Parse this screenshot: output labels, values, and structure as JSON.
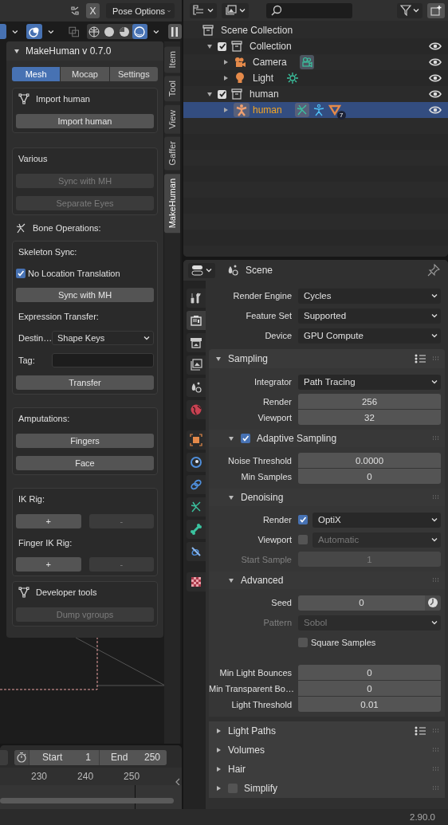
{
  "viewport_header": {
    "close_label": "X",
    "pose_options": "Pose Options"
  },
  "shading": [
    {
      "kind": "wireframe",
      "selected": false
    },
    {
      "kind": "solid",
      "selected": false
    },
    {
      "kind": "material",
      "selected": false
    },
    {
      "kind": "rendered",
      "selected": true
    }
  ],
  "n_panel": {
    "title": "MakeHuman v 0.7.0",
    "tabs": [
      {
        "label": "Mesh",
        "selected": true
      },
      {
        "label": "Mocap",
        "selected": false
      },
      {
        "label": "Settings",
        "selected": false
      }
    ],
    "blocks": [
      {
        "kind": "icon_box",
        "title": "Import human",
        "rows": [
          {
            "kind": "button",
            "label": "Import human",
            "disabled": false
          }
        ]
      },
      {
        "kind": "box",
        "title": "Various",
        "rows": [
          {
            "kind": "button",
            "label": "Sync with MH",
            "disabled": true
          },
          {
            "kind": "button",
            "label": "Separate Eyes",
            "disabled": true
          }
        ]
      },
      {
        "kind": "heading",
        "title": "Bone Operations:"
      },
      {
        "kind": "box",
        "title": "Skeleton Sync:",
        "rows": [
          {
            "kind": "checkbox",
            "label": "No Location Translation",
            "checked": true
          },
          {
            "kind": "button",
            "label": "Sync with MH",
            "disabled": false
          },
          {
            "kind": "label",
            "label": "Expression Transfer:"
          },
          {
            "kind": "dropdown",
            "label": "Destin…",
            "value": "Shape Keys"
          },
          {
            "kind": "text_field",
            "label": "Tag:"
          },
          {
            "kind": "button",
            "label": "Transfer",
            "disabled": false
          }
        ]
      },
      {
        "kind": "box",
        "title": "Amputations:",
        "rows": [
          {
            "kind": "button",
            "label": "Fingers",
            "disabled": false
          },
          {
            "kind": "button",
            "label": "Face",
            "disabled": false
          }
        ]
      },
      {
        "kind": "box",
        "title": "IK Rig:",
        "rows": [
          {
            "kind": "button_pair",
            "buttons": [
              {
                "label": "+",
                "disabled": false
              },
              {
                "label": "-",
                "disabled": true
              }
            ]
          },
          {
            "kind": "label",
            "label": "Finger IK Rig:"
          },
          {
            "kind": "button_pair",
            "buttons": [
              {
                "label": "+",
                "disabled": false
              },
              {
                "label": "-",
                "disabled": true
              }
            ]
          }
        ]
      },
      {
        "kind": "icon_box",
        "title": "Developer tools",
        "rows": [
          {
            "kind": "button",
            "label": "Dump vgroups",
            "disabled": true
          }
        ]
      }
    ]
  },
  "sidebar_tabs": [
    {
      "label": "Item",
      "selected": false
    },
    {
      "label": "Tool",
      "selected": false
    },
    {
      "label": "View",
      "selected": false
    },
    {
      "label": "Gaffer",
      "selected": false
    },
    {
      "label": "MakeHuman",
      "selected": true
    }
  ],
  "timeline": {
    "start_label": "Start",
    "start": "1",
    "end_label": "End",
    "end": "250",
    "ticks": [
      "230",
      "240",
      "250"
    ]
  },
  "outliner": {
    "items": [
      {
        "label": "Scene Collection",
        "kind": "scene_collection",
        "selected": false,
        "children": [
          {
            "label": "Collection",
            "kind": "collection",
            "checked": true,
            "expanded": true,
            "visible": true,
            "selected": false,
            "children": [
              {
                "label": "Camera",
                "kind": "camera",
                "expanded": false,
                "visible": true,
                "selected": false
              },
              {
                "label": "Light",
                "kind": "light",
                "expanded": false,
                "visible": true,
                "selected": false
              }
            ]
          },
          {
            "label": "human",
            "kind": "collection",
            "checked": true,
            "expanded": true,
            "visible": true,
            "selected": false,
            "children": [
              {
                "label": "human",
                "kind": "armature",
                "expanded": false,
                "visible": true,
                "selected": true,
                "badge": "7"
              }
            ]
          }
        ]
      }
    ]
  },
  "properties": {
    "title": "Scene",
    "tabs": [
      {
        "kind": "tool",
        "selected": false
      },
      {
        "kind": "render",
        "selected": true
      },
      {
        "kind": "output",
        "selected": false
      },
      {
        "kind": "view_layer",
        "selected": false
      },
      {
        "kind": "scene",
        "selected": false
      },
      {
        "kind": "world",
        "selected": false
      },
      {
        "kind": "object",
        "selected": false
      },
      {
        "kind": "physics",
        "selected": false
      },
      {
        "kind": "constraints",
        "selected": false
      },
      {
        "kind": "data",
        "selected": false
      },
      {
        "kind": "bone",
        "selected": false
      },
      {
        "kind": "bone_constraints",
        "selected": false
      },
      {
        "kind": "texture",
        "selected": false
      }
    ],
    "rows": [
      {
        "kind": "dropdown",
        "label": "Render Engine",
        "value": "Cycles",
        "disabled": false
      },
      {
        "kind": "dropdown",
        "label": "Feature Set",
        "value": "Supported",
        "disabled": false
      },
      {
        "kind": "dropdown",
        "label": "Device",
        "value": "GPU Compute",
        "disabled": false
      }
    ],
    "panels": [
      {
        "kind": "panel",
        "title": "Sampling",
        "expanded": true,
        "presets": true,
        "rows": [
          {
            "kind": "dropdown",
            "label": "Integrator",
            "value": "Path Tracing",
            "disabled": false
          },
          {
            "kind": "number_group",
            "items": [
              {
                "label": "Render",
                "value": "256",
                "disabled": false
              },
              {
                "label": "Viewport",
                "value": "32",
                "disabled": false
              }
            ]
          }
        ]
      },
      {
        "kind": "subpanel",
        "title": "Adaptive Sampling",
        "expanded": true,
        "checked": true,
        "rows": [
          {
            "kind": "number_group",
            "items": [
              {
                "label": "Noise Threshold",
                "value": "0.0000",
                "disabled": false
              },
              {
                "label": "Min Samples",
                "value": "0",
                "disabled": false
              }
            ]
          }
        ]
      },
      {
        "kind": "subpanel",
        "title": "Denoising",
        "expanded": true,
        "rows": [
          {
            "kind": "check_dropdown",
            "label": "Render",
            "checked": true,
            "value": "OptiX",
            "disabled": false
          },
          {
            "kind": "check_dropdown",
            "label": "Viewport",
            "checked": false,
            "value": "Automatic",
            "disabled": true
          },
          {
            "kind": "number_group",
            "items": [
              {
                "label": "Start Sample",
                "value": "1",
                "disabled": true
              }
            ]
          }
        ]
      },
      {
        "kind": "subpanel",
        "title": "Advanced",
        "expanded": true,
        "rows": [
          {
            "kind": "number_button",
            "label": "Seed",
            "value": "0",
            "disabled": false
          },
          {
            "kind": "dropdown",
            "label": "Pattern",
            "value": "Sobol",
            "disabled": true
          },
          {
            "kind": "checkbox",
            "label": "Square Samples",
            "checked": false,
            "disabled": false
          },
          {
            "kind": "number_group",
            "items": [
              {
                "label": "Min Light Bounces",
                "value": "0",
                "disabled": false
              },
              {
                "label": "Min Transparent Bo…",
                "value": "0",
                "disabled": false
              },
              {
                "label": "Light Threshold",
                "value": "0.01",
                "disabled": false
              }
            ]
          }
        ]
      },
      {
        "kind": "panel",
        "title": "Light Paths",
        "expanded": false,
        "presets": true
      },
      {
        "kind": "panel",
        "title": "Volumes",
        "expanded": false,
        "presets": false
      },
      {
        "kind": "panel",
        "title": "Hair",
        "expanded": false,
        "presets": false
      },
      {
        "kind": "panel",
        "title": "Simplify",
        "expanded": false,
        "presets": false,
        "checked": false
      }
    ]
  },
  "status_bar": {
    "version": "2.90.0"
  }
}
